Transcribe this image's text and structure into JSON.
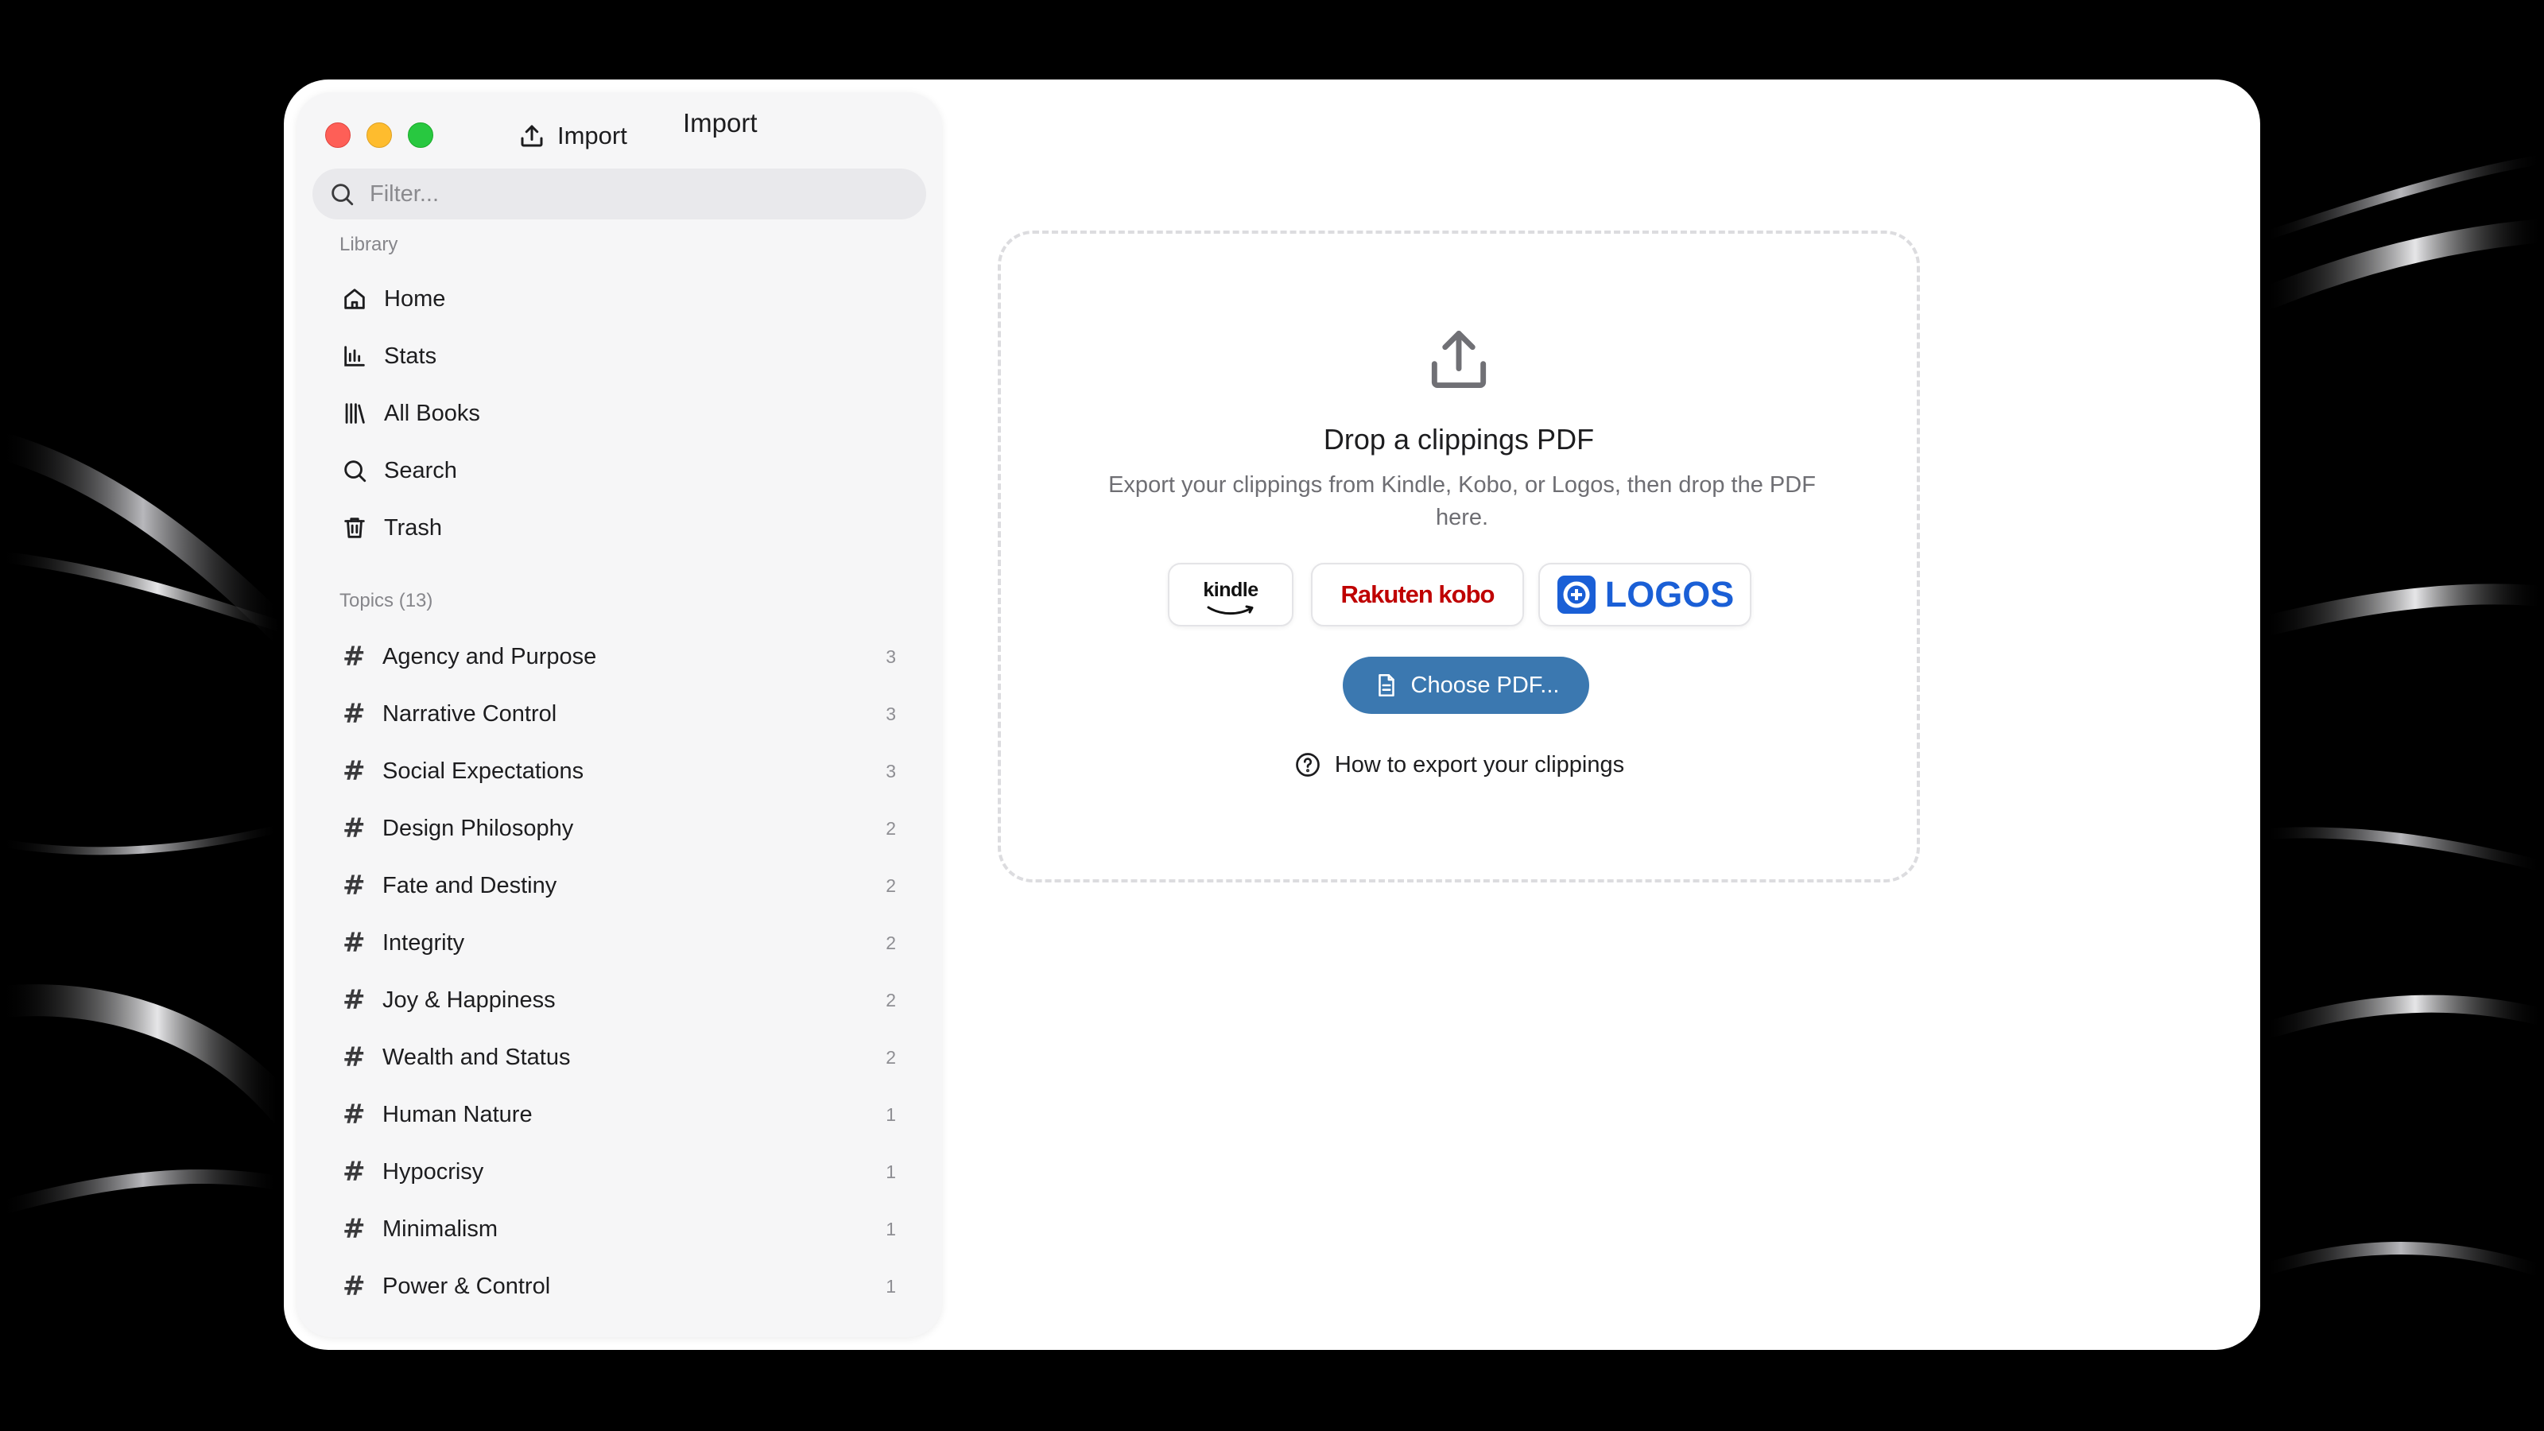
{
  "sidebar": {
    "import_label": "Import",
    "filter_placeholder": "Filter...",
    "library_label": "Library",
    "library_items": [
      {
        "label": "Home",
        "icon": "home-icon"
      },
      {
        "label": "Stats",
        "icon": "bar-chart-icon"
      },
      {
        "label": "All Books",
        "icon": "library-icon"
      },
      {
        "label": "Search",
        "icon": "search-icon"
      },
      {
        "label": "Trash",
        "icon": "trash-icon"
      }
    ],
    "topics_label": "Topics (13)",
    "topics": [
      {
        "label": "Agency and Purpose",
        "count": "3"
      },
      {
        "label": "Narrative Control",
        "count": "3"
      },
      {
        "label": "Social Expectations",
        "count": "3"
      },
      {
        "label": "Design Philosophy",
        "count": "2"
      },
      {
        "label": "Fate and Destiny",
        "count": "2"
      },
      {
        "label": "Integrity",
        "count": "2"
      },
      {
        "label": "Joy & Happiness",
        "count": "2"
      },
      {
        "label": "Wealth and Status",
        "count": "2"
      },
      {
        "label": "Human Nature",
        "count": "1"
      },
      {
        "label": "Hypocrisy",
        "count": "1"
      },
      {
        "label": "Minimalism",
        "count": "1"
      },
      {
        "label": "Power & Control",
        "count": "1"
      }
    ]
  },
  "main": {
    "title": "Import",
    "dropzone": {
      "title": "Drop a clippings PDF",
      "description": "Export your clippings from Kindle, Kobo, or Logos, then drop the PDF here.",
      "brands": {
        "kindle": "kindle",
        "kobo": "Rakuten kobo",
        "logos": "LOGOS"
      },
      "choose_label": "Choose PDF...",
      "howto_label": "How to export your clippings"
    }
  },
  "colors": {
    "accent": "#3b78b0",
    "close": "#fe5f57",
    "minimize": "#febc2e",
    "maximize": "#28c840",
    "kobo": "#bf0000",
    "logos": "#1a5fd6"
  }
}
